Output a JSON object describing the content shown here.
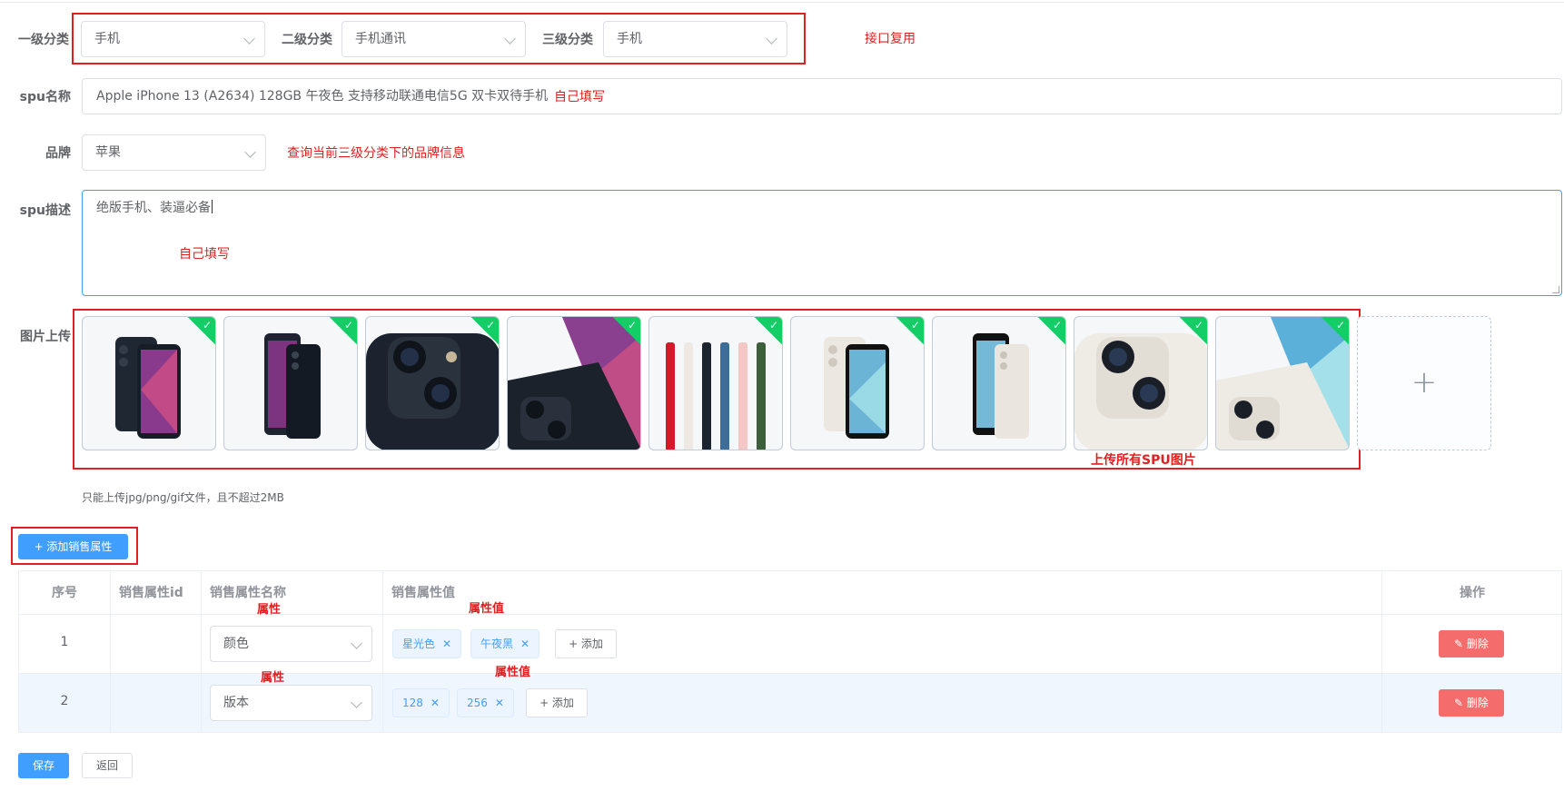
{
  "category": {
    "level1_label": "一级分类",
    "level1_value": "手机",
    "level2_label": "二级分类",
    "level2_value": "手机通讯",
    "level3_label": "三级分类",
    "level3_value": "手机"
  },
  "spu_name": {
    "label": "spu名称",
    "value": "Apple iPhone 13 (A2634) 128GB 午夜色 支持移动联通电信5G 双卡双待手机"
  },
  "brand": {
    "label": "品牌",
    "value": "苹果"
  },
  "description": {
    "label": "spu描述",
    "value": "绝版手机、装逼必备"
  },
  "images": {
    "label": "图片上传",
    "tip": "只能上传jpg/png/gif文件，且不超过2MB",
    "add_symbol": "+"
  },
  "annotations": {
    "interface_reuse": "接口复用",
    "self_fill_1": "自己填写",
    "brand_query": "查询当前三级分类下的品牌信息",
    "self_fill_2": "自己填写",
    "upload_all": "上传所有SPU图片",
    "attr_1": "属性",
    "attr_value_1": "属性值",
    "attr_2": "属性",
    "attr_value_2": "属性值"
  },
  "add_sale_attr_button": "+ 添加销售属性",
  "table": {
    "headers": {
      "index": "序号",
      "attr_id": "销售属性id",
      "attr_name": "销售属性名称",
      "attr_values": "销售属性值",
      "actions": "操作"
    },
    "rows": [
      {
        "index": "1",
        "attr_name": "颜色",
        "values": [
          "星光色",
          "午夜黑"
        ],
        "add_label": "+ 添加",
        "delete_label": "删除"
      },
      {
        "index": "2",
        "attr_name": "版本",
        "values": [
          "128",
          "256"
        ],
        "add_label": "+ 添加",
        "delete_label": "删除"
      }
    ]
  },
  "footer": {
    "save": "保存",
    "back": "返回"
  },
  "colors": {
    "primary": "#409eff",
    "danger": "#f56c6c",
    "annotation_red": "#e02020",
    "success": "#13ce66"
  }
}
